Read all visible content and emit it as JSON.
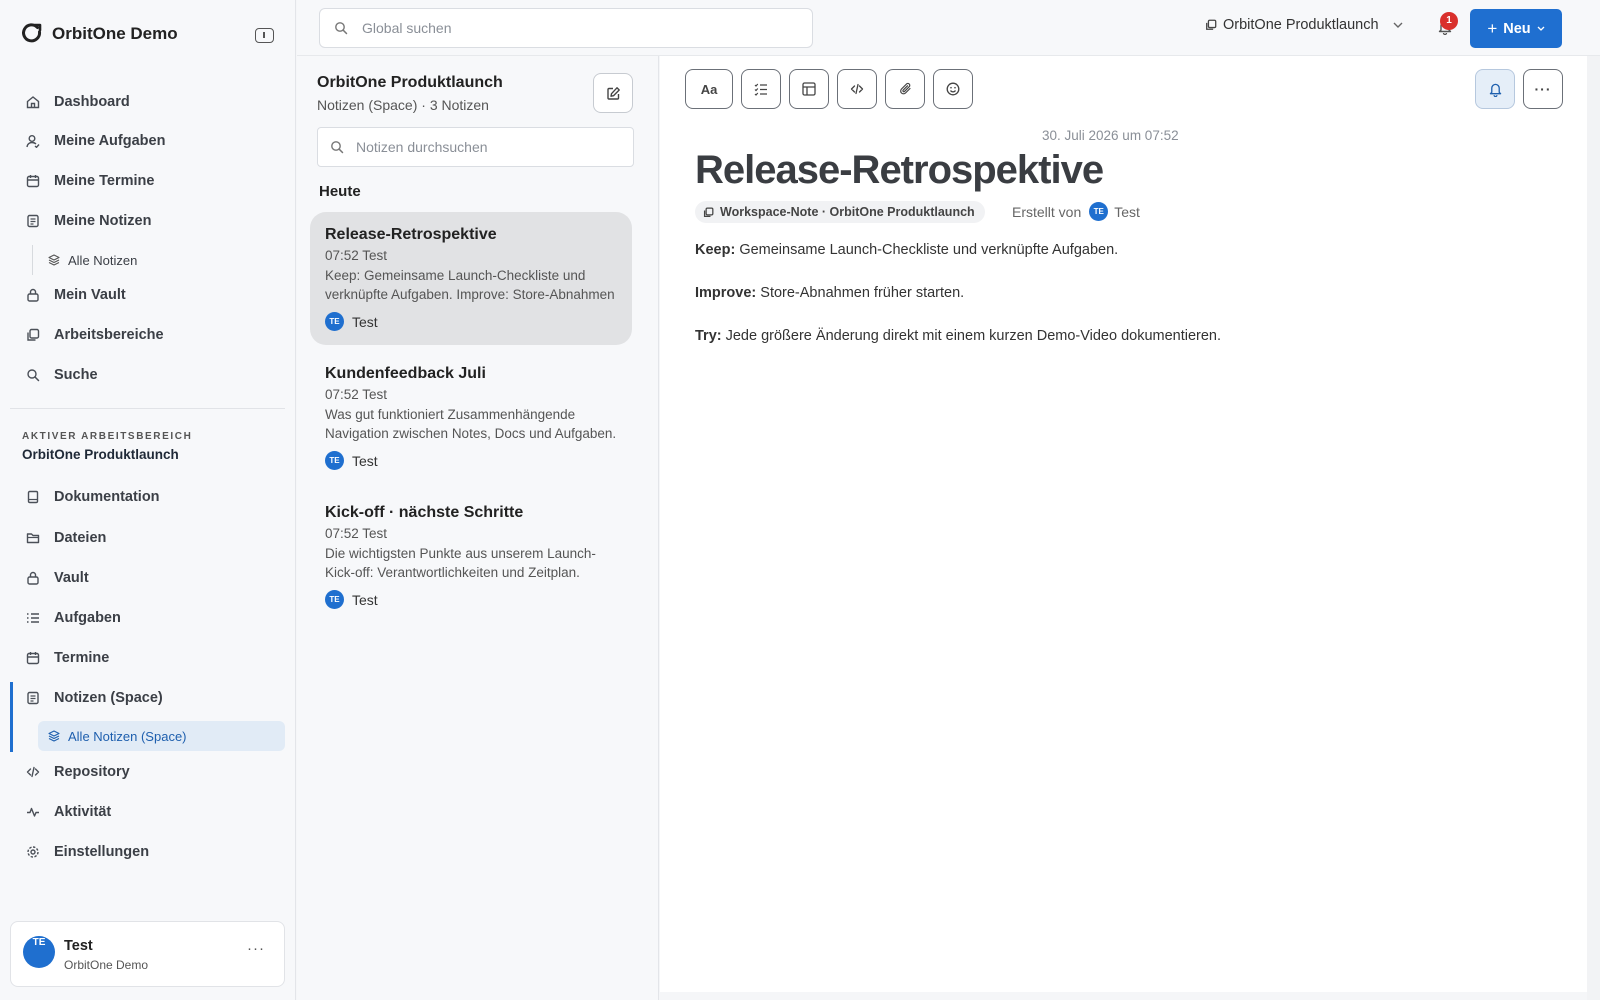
{
  "app": {
    "name": "OrbitOne Demo"
  },
  "sidebar": {
    "nav": [
      {
        "label": "Dashboard",
        "icon": "home-icon"
      },
      {
        "label": "Meine Aufgaben",
        "icon": "user-icon"
      },
      {
        "label": "Meine Termine",
        "icon": "calendar-icon"
      },
      {
        "label": "Meine Notizen",
        "icon": "note-icon"
      }
    ],
    "my_notes_sub": "Alle Notizen",
    "nav2": [
      {
        "label": "Mein Vault",
        "icon": "lock-icon"
      },
      {
        "label": "Arbeitsbereiche",
        "icon": "spaces-icon"
      },
      {
        "label": "Suche",
        "icon": "search-icon"
      }
    ],
    "workspace_eyebrow": "AKTIVER ARBEITSBEREICH",
    "workspace_name": "OrbitOne Produktlaunch",
    "ws_nav": [
      {
        "label": "Dokumentation",
        "icon": "doc-icon"
      },
      {
        "label": "Dateien",
        "icon": "folder-icon"
      },
      {
        "label": "Vault",
        "icon": "lock-icon"
      },
      {
        "label": "Aufgaben",
        "icon": "tasks-icon"
      },
      {
        "label": "Termine",
        "icon": "calendar-icon"
      },
      {
        "label": "Notizen (Space)",
        "icon": "note-icon"
      }
    ],
    "space_notes_sub": "Alle Notizen (Space)",
    "ws_nav2": [
      {
        "label": "Repository",
        "icon": "code-icon"
      },
      {
        "label": "Aktivität",
        "icon": "activity-icon"
      },
      {
        "label": "Einstellungen",
        "icon": "gear-icon"
      }
    ],
    "user": {
      "initials": "TE",
      "name": "Test",
      "org": "OrbitOne Demo",
      "more": "···"
    }
  },
  "topbar": {
    "search_placeholder": "Global suchen",
    "workspace_switcher": "OrbitOne Produktlaunch",
    "notification_count": "1",
    "new_label": "Neu"
  },
  "notes_list": {
    "title": "OrbitOne Produktlaunch",
    "subtitle": "Notizen (Space) · 3 Notizen",
    "search_placeholder": "Notizen durchsuchen",
    "group": "Heute",
    "notes": [
      {
        "title": "Release-Retrospektive",
        "meta": "07:52 Test",
        "snippet": "Keep: Gemeinsame Launch-Checkliste und verknüpfte Aufgaben. Improve: Store-Abnahmen früher starten.",
        "initials": "TE",
        "author": "Test"
      },
      {
        "title": "Kundenfeedback Juli",
        "meta": "07:52 Test",
        "snippet": "Was gut funktioniert Zusammenhängende Navigation zwischen Notes, Docs und Aufgaben.",
        "initials": "TE",
        "author": "Test"
      },
      {
        "title": "Kick-off · nächste Schritte",
        "meta": "07:52 Test",
        "snippet": "Die wichtigsten Punkte aus unserem Launch-Kick-off: Verantwortlichkeiten und Zeitplan.",
        "initials": "TE",
        "author": "Test"
      }
    ]
  },
  "editor": {
    "toolbar": {
      "text_style": "Aa",
      "more": "···"
    },
    "timestamp": "30. Juli 2026 um 07:52",
    "title": "Release-Retrospektive",
    "workspace_chip": "Workspace-Note · OrbitOne Produktlaunch",
    "created_by_label": "Erstellt von",
    "author_initials": "TE",
    "author": "Test",
    "paragraphs": [
      {
        "label": "Keep:",
        "text": " Gemeinsame Launch-Checkliste und verknüpfte Aufgaben."
      },
      {
        "label": "Improve:",
        "text": " Store-Abnahmen früher starten."
      },
      {
        "label": "Try:",
        "text": " Jede größere Änderung direkt mit einem kurzen Demo-Video dokumentieren."
      }
    ]
  },
  "colors": {
    "accent": "#1f6fd0",
    "badge": "#d9302c",
    "active_bg": "#e1ebf6"
  }
}
